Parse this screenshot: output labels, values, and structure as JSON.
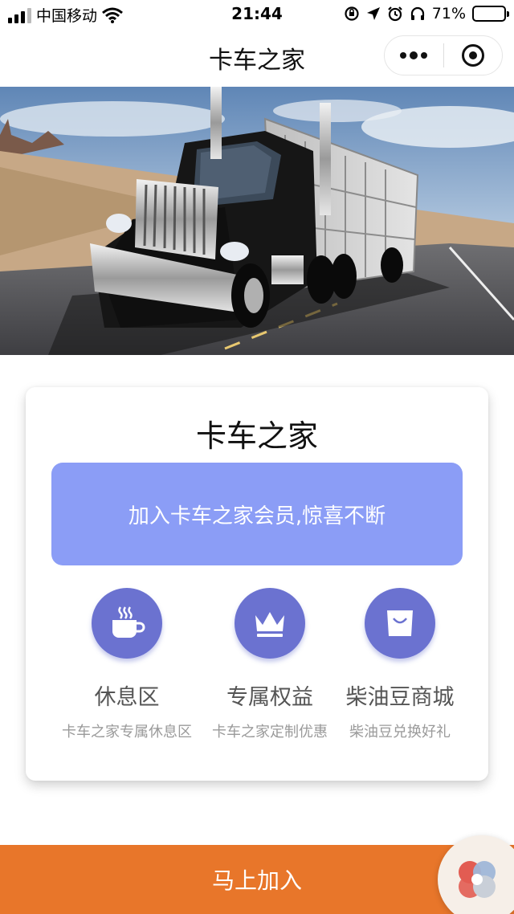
{
  "status_bar": {
    "carrier": "中国移动",
    "time": "21:44",
    "battery": "71%",
    "battery_level": 0.71
  },
  "nav": {
    "title": "卡车之家",
    "more_icon": "more-dots-icon",
    "close_icon": "target-icon"
  },
  "hero": {
    "icon": "truck-photo"
  },
  "card": {
    "title": "卡车之家",
    "member_button": "加入卡车之家会员,惊喜不断",
    "accent_color": "#8b9df6",
    "icon_color": "#6b72d0",
    "features": [
      {
        "icon": "coffee-cup-icon",
        "title": "休息区",
        "subtitle": "卡车之家专属休息区"
      },
      {
        "icon": "crown-icon",
        "title": "专属权益",
        "subtitle": "卡车之家定制优惠"
      },
      {
        "icon": "shopping-bag-icon",
        "title": "柴油豆商城",
        "subtitle": "柴油豆兑换好礼"
      }
    ]
  },
  "join": {
    "label": "马上加入",
    "color": "#e8762a"
  }
}
